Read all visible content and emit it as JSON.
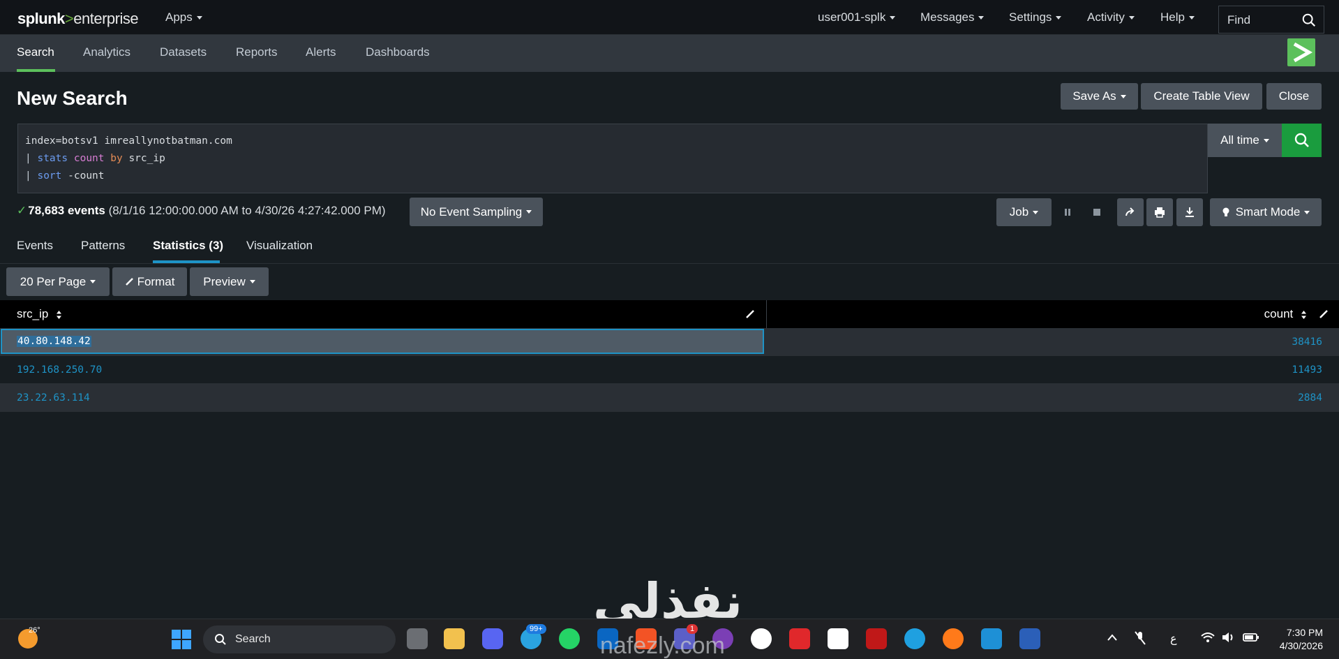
{
  "brand": {
    "name": "splunk",
    "separator": ">",
    "product": "enterprise"
  },
  "topnav": {
    "apps": "Apps",
    "user": "user001-splk",
    "messages": "Messages",
    "settings": "Settings",
    "activity": "Activity",
    "help": "Help",
    "find_label": "Find"
  },
  "appnav": {
    "items": [
      {
        "label": "Search"
      },
      {
        "label": "Analytics"
      },
      {
        "label": "Datasets"
      },
      {
        "label": "Reports"
      },
      {
        "label": "Alerts"
      },
      {
        "label": "Dashboards"
      }
    ]
  },
  "page": {
    "title": "New Search",
    "save_as": "Save As",
    "create_table_view": "Create Table View",
    "close": "Close"
  },
  "search": {
    "line1": "index=botsv1 imreallynotbatman.com",
    "line2": {
      "pipe": "|",
      "cmd": "stats",
      "fn": "count",
      "by": "by",
      "field": "src_ip"
    },
    "line3": {
      "pipe": "|",
      "cmd": "sort",
      "arg": "-count"
    },
    "time_range": "All time"
  },
  "status": {
    "events": "78,683 events",
    "range": "(8/1/16 12:00:00.000 AM to 4/30/26 4:27:42.000 PM)",
    "sampling": "No Event Sampling",
    "job": "Job",
    "mode": "Smart Mode"
  },
  "tabs": [
    {
      "label": "Events"
    },
    {
      "label": "Patterns"
    },
    {
      "label": "Statistics (3)"
    },
    {
      "label": "Visualization"
    }
  ],
  "table_controls": {
    "per_page": "20 Per Page",
    "format": "Format",
    "preview": "Preview"
  },
  "table": {
    "columns": [
      "src_ip",
      "count"
    ],
    "rows": [
      {
        "src_ip": "40.80.148.42",
        "count": "38416"
      },
      {
        "src_ip": "192.168.250.70",
        "count": "11493"
      },
      {
        "src_ip": "23.22.63.114",
        "count": "2884"
      }
    ]
  },
  "watermark": {
    "main": "نفذلي",
    "sub": "nafezly.com"
  },
  "taskbar": {
    "temperature": "26°",
    "search": "Search",
    "badge_telegram": "99+",
    "badge_app": "1",
    "lang": "ع",
    "time": "7:30 PM",
    "date": "4/30/2026"
  },
  "colors": {
    "accent_green": "#5cc05c",
    "link_blue": "#1e93c6",
    "search_green": "#1a9c3e"
  }
}
